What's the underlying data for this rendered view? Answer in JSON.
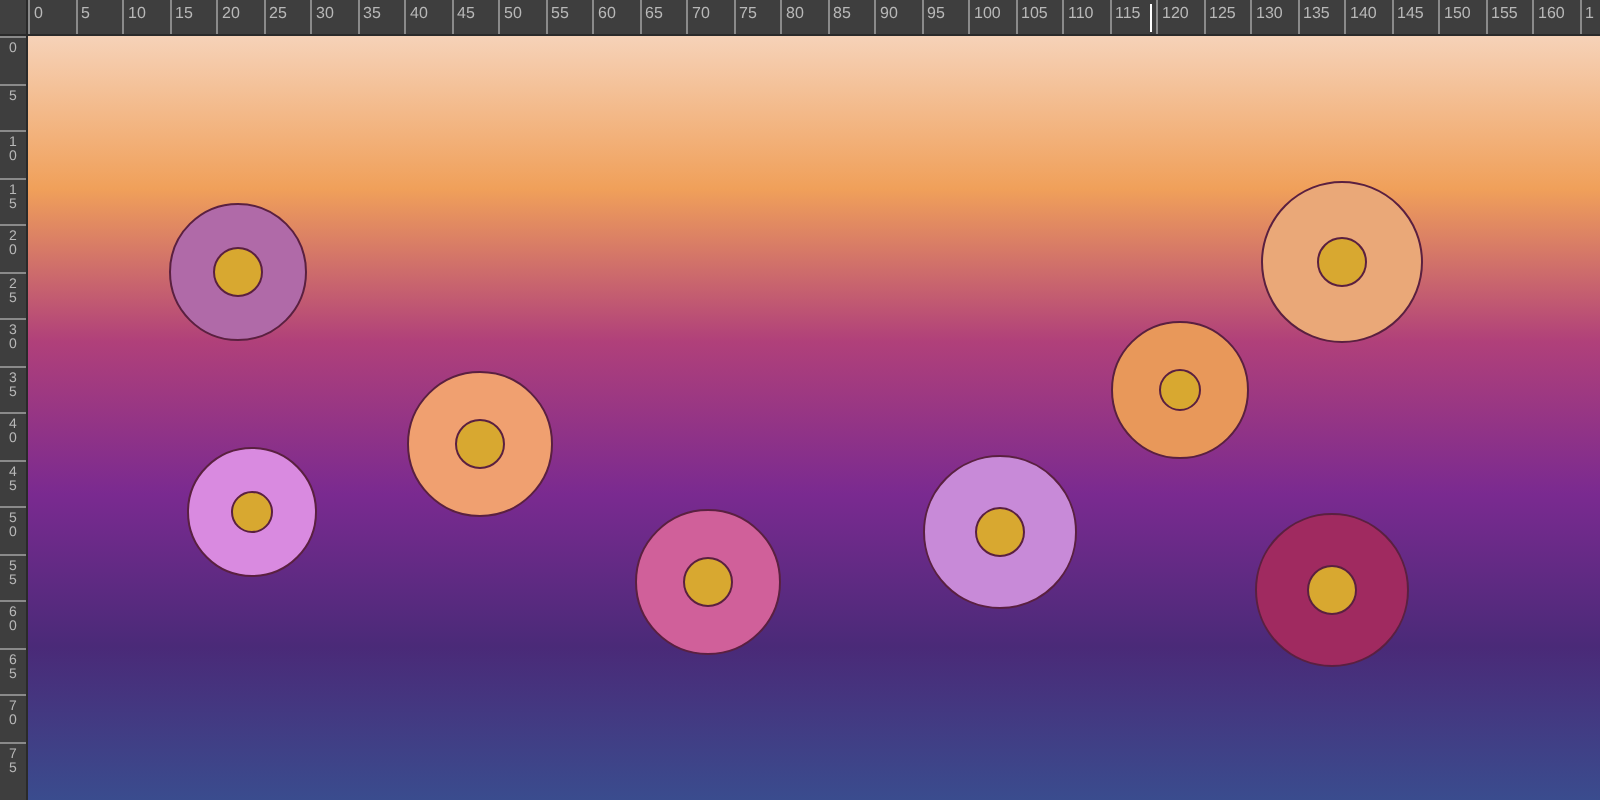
{
  "top_ruler": {
    "labels": [
      "0",
      "5",
      "10",
      "15",
      "20",
      "25",
      "30",
      "35",
      "40",
      "45",
      "50",
      "55",
      "60",
      "65",
      "70",
      "75",
      "80",
      "85",
      "90",
      "95",
      "100",
      "105",
      "110",
      "115",
      "120",
      "125",
      "130",
      "135",
      "140",
      "145",
      "150",
      "155",
      "160",
      "1"
    ]
  },
  "left_ruler": {
    "labels": [
      "0",
      "5",
      "10",
      "15",
      "20",
      "25",
      "30",
      "35",
      "40",
      "45",
      "50",
      "55",
      "60",
      "65",
      "70",
      "75"
    ]
  }
}
